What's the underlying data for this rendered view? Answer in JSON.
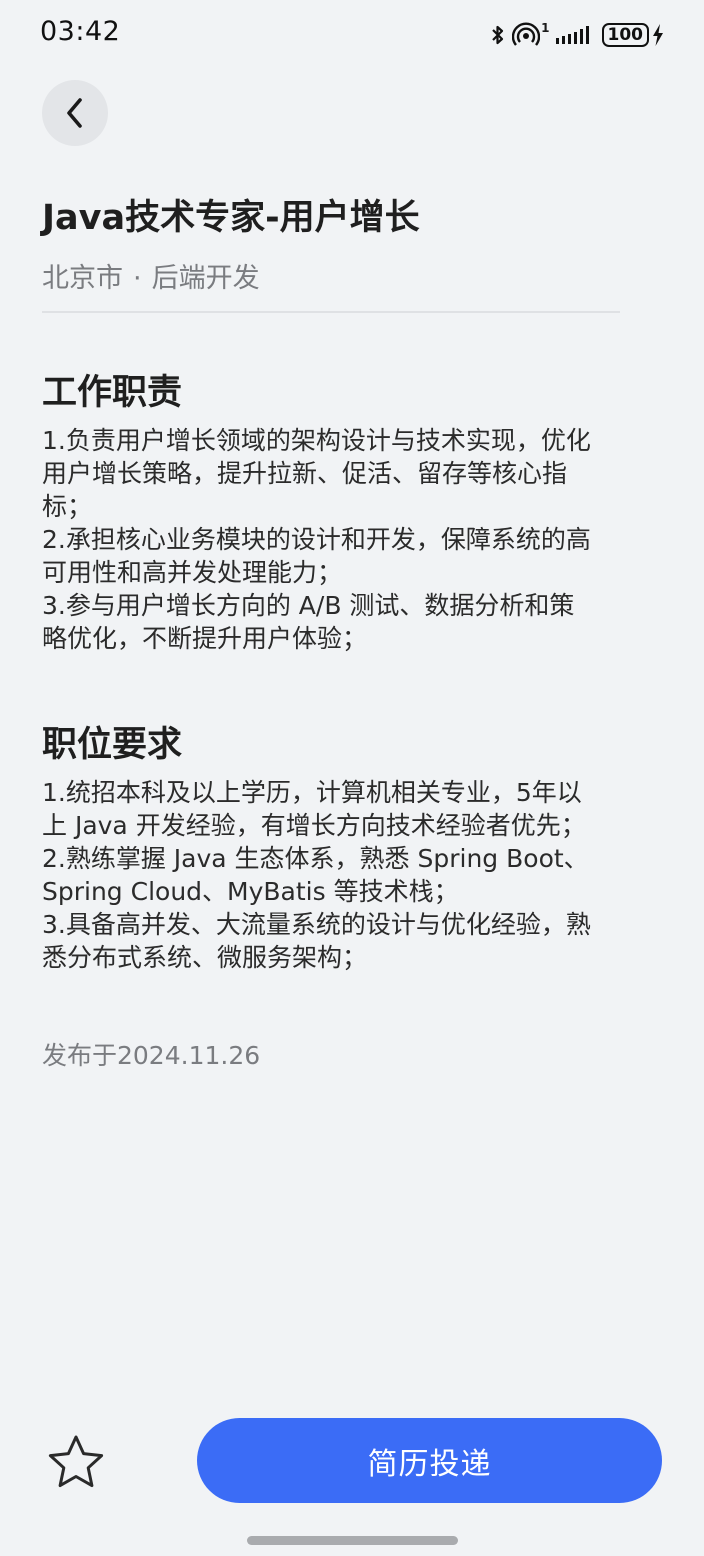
{
  "status_bar": {
    "time": "03:42",
    "signal_sub": "1",
    "battery_level": "100",
    "icons": [
      "bluetooth-icon",
      "hotspot-icon",
      "signal-icon",
      "battery-icon",
      "charging-icon"
    ]
  },
  "header": {
    "back_icon": "chevron-left-icon"
  },
  "job": {
    "title": "Java技术专家-用户增长",
    "location": "北京市",
    "separator": "·",
    "category": "后端开发"
  },
  "responsibilities": {
    "heading": "工作职责",
    "lines": [
      "1.负责用户增长领域的架构设计与技术实现，优化",
      "用户增长策略，提升拉新、促活、留存等核心指",
      "标；",
      "2.承担核心业务模块的设计和开发，保障系统的高",
      "可用性和高并发处理能力；",
      "3.参与用户增长方向的 A/B 测试、数据分析和策",
      "略优化，不断提升用户体验；"
    ]
  },
  "requirements": {
    "heading": "职位要求",
    "lines": [
      "1.统招本科及以上学历，计算机相关专业，5年以",
      "上 Java 开发经验，有增长方向技术经验者优先；",
      "2.熟练掌握 Java 生态体系，熟悉 Spring Boot、",
      "Spring Cloud、MyBatis 等技术栈；",
      "3.具备高并发、大流量系统的设计与优化经验，熟",
      "悉分布式系统、微服务架构；"
    ]
  },
  "publish": {
    "date_text": "发布于2024.11.26"
  },
  "actions": {
    "favorite_icon": "star-outline-icon",
    "apply_label": "简历投递"
  },
  "colors": {
    "background": "#f1f3f5",
    "accent": "#3b6cf6",
    "secondary_text": "#7a7c80"
  }
}
